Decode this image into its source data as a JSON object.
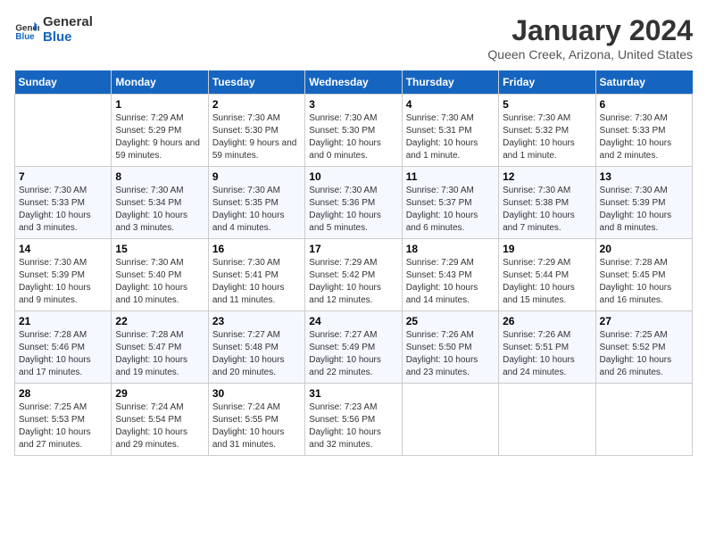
{
  "logo": {
    "line1": "General",
    "line2": "Blue"
  },
  "title": "January 2024",
  "subtitle": "Queen Creek, Arizona, United States",
  "days_of_week": [
    "Sunday",
    "Monday",
    "Tuesday",
    "Wednesday",
    "Thursday",
    "Friday",
    "Saturday"
  ],
  "weeks": [
    [
      {
        "num": "",
        "empty": true
      },
      {
        "num": "1",
        "sunrise": "7:29 AM",
        "sunset": "5:29 PM",
        "daylight": "9 hours and 59 minutes."
      },
      {
        "num": "2",
        "sunrise": "7:30 AM",
        "sunset": "5:30 PM",
        "daylight": "9 hours and 59 minutes."
      },
      {
        "num": "3",
        "sunrise": "7:30 AM",
        "sunset": "5:30 PM",
        "daylight": "10 hours and 0 minutes."
      },
      {
        "num": "4",
        "sunrise": "7:30 AM",
        "sunset": "5:31 PM",
        "daylight": "10 hours and 1 minute."
      },
      {
        "num": "5",
        "sunrise": "7:30 AM",
        "sunset": "5:32 PM",
        "daylight": "10 hours and 1 minute."
      },
      {
        "num": "6",
        "sunrise": "7:30 AM",
        "sunset": "5:33 PM",
        "daylight": "10 hours and 2 minutes."
      }
    ],
    [
      {
        "num": "7",
        "sunrise": "7:30 AM",
        "sunset": "5:33 PM",
        "daylight": "10 hours and 3 minutes."
      },
      {
        "num": "8",
        "sunrise": "7:30 AM",
        "sunset": "5:34 PM",
        "daylight": "10 hours and 3 minutes."
      },
      {
        "num": "9",
        "sunrise": "7:30 AM",
        "sunset": "5:35 PM",
        "daylight": "10 hours and 4 minutes."
      },
      {
        "num": "10",
        "sunrise": "7:30 AM",
        "sunset": "5:36 PM",
        "daylight": "10 hours and 5 minutes."
      },
      {
        "num": "11",
        "sunrise": "7:30 AM",
        "sunset": "5:37 PM",
        "daylight": "10 hours and 6 minutes."
      },
      {
        "num": "12",
        "sunrise": "7:30 AM",
        "sunset": "5:38 PM",
        "daylight": "10 hours and 7 minutes."
      },
      {
        "num": "13",
        "sunrise": "7:30 AM",
        "sunset": "5:39 PM",
        "daylight": "10 hours and 8 minutes."
      }
    ],
    [
      {
        "num": "14",
        "sunrise": "7:30 AM",
        "sunset": "5:39 PM",
        "daylight": "10 hours and 9 minutes."
      },
      {
        "num": "15",
        "sunrise": "7:30 AM",
        "sunset": "5:40 PM",
        "daylight": "10 hours and 10 minutes."
      },
      {
        "num": "16",
        "sunrise": "7:30 AM",
        "sunset": "5:41 PM",
        "daylight": "10 hours and 11 minutes."
      },
      {
        "num": "17",
        "sunrise": "7:29 AM",
        "sunset": "5:42 PM",
        "daylight": "10 hours and 12 minutes."
      },
      {
        "num": "18",
        "sunrise": "7:29 AM",
        "sunset": "5:43 PM",
        "daylight": "10 hours and 14 minutes."
      },
      {
        "num": "19",
        "sunrise": "7:29 AM",
        "sunset": "5:44 PM",
        "daylight": "10 hours and 15 minutes."
      },
      {
        "num": "20",
        "sunrise": "7:28 AM",
        "sunset": "5:45 PM",
        "daylight": "10 hours and 16 minutes."
      }
    ],
    [
      {
        "num": "21",
        "sunrise": "7:28 AM",
        "sunset": "5:46 PM",
        "daylight": "10 hours and 17 minutes."
      },
      {
        "num": "22",
        "sunrise": "7:28 AM",
        "sunset": "5:47 PM",
        "daylight": "10 hours and 19 minutes."
      },
      {
        "num": "23",
        "sunrise": "7:27 AM",
        "sunset": "5:48 PM",
        "daylight": "10 hours and 20 minutes."
      },
      {
        "num": "24",
        "sunrise": "7:27 AM",
        "sunset": "5:49 PM",
        "daylight": "10 hours and 22 minutes."
      },
      {
        "num": "25",
        "sunrise": "7:26 AM",
        "sunset": "5:50 PM",
        "daylight": "10 hours and 23 minutes."
      },
      {
        "num": "26",
        "sunrise": "7:26 AM",
        "sunset": "5:51 PM",
        "daylight": "10 hours and 24 minutes."
      },
      {
        "num": "27",
        "sunrise": "7:25 AM",
        "sunset": "5:52 PM",
        "daylight": "10 hours and 26 minutes."
      }
    ],
    [
      {
        "num": "28",
        "sunrise": "7:25 AM",
        "sunset": "5:53 PM",
        "daylight": "10 hours and 27 minutes."
      },
      {
        "num": "29",
        "sunrise": "7:24 AM",
        "sunset": "5:54 PM",
        "daylight": "10 hours and 29 minutes."
      },
      {
        "num": "30",
        "sunrise": "7:24 AM",
        "sunset": "5:55 PM",
        "daylight": "10 hours and 31 minutes."
      },
      {
        "num": "31",
        "sunrise": "7:23 AM",
        "sunset": "5:56 PM",
        "daylight": "10 hours and 32 minutes."
      },
      {
        "num": "",
        "empty": true
      },
      {
        "num": "",
        "empty": true
      },
      {
        "num": "",
        "empty": true
      }
    ]
  ],
  "labels": {
    "sunrise_prefix": "Sunrise: ",
    "sunset_prefix": "Sunset: ",
    "daylight_prefix": "Daylight: "
  }
}
